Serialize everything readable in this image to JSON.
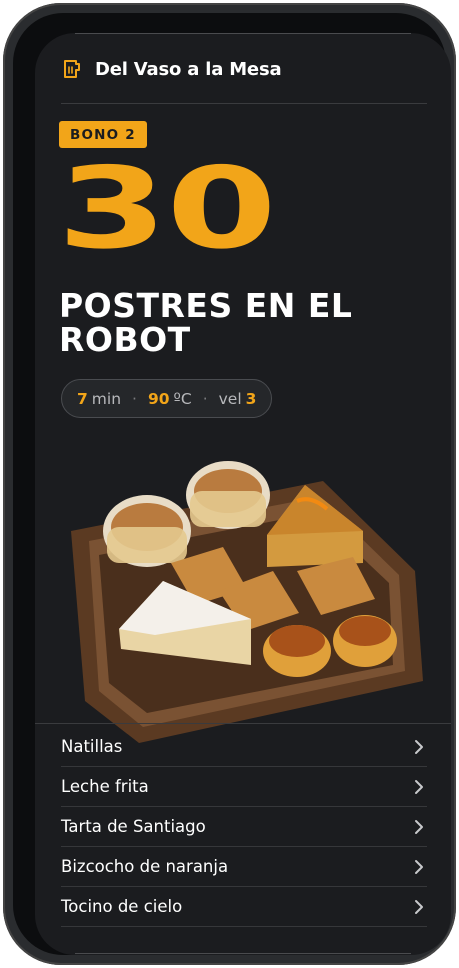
{
  "header": {
    "logo_icon": "cup-utensils-icon",
    "title": "Del Vaso a la Mesa"
  },
  "hero": {
    "badge": "BONO 2",
    "number": "30",
    "title": "POSTRES EN EL ROBOT",
    "stats": {
      "time_value": "7",
      "time_unit": "min",
      "temp_value": "90",
      "temp_unit": "ºC",
      "speed_label": "vel",
      "speed_value": "3",
      "separator": "·"
    },
    "image": "tray-of-spanish-desserts"
  },
  "recipes": [
    {
      "label": "Natillas",
      "icon": "chevron-right-icon"
    },
    {
      "label": "Leche frita",
      "icon": "chevron-right-icon"
    },
    {
      "label": "Tarta de Santiago",
      "icon": "chevron-right-icon"
    },
    {
      "label": "Bizcocho de naranja",
      "icon": "chevron-right-icon"
    },
    {
      "label": "Tocino de cielo",
      "icon": "chevron-right-icon"
    }
  ],
  "colors": {
    "accent": "#f2a519",
    "background": "#1b1c1f",
    "text": "#ffffff"
  }
}
